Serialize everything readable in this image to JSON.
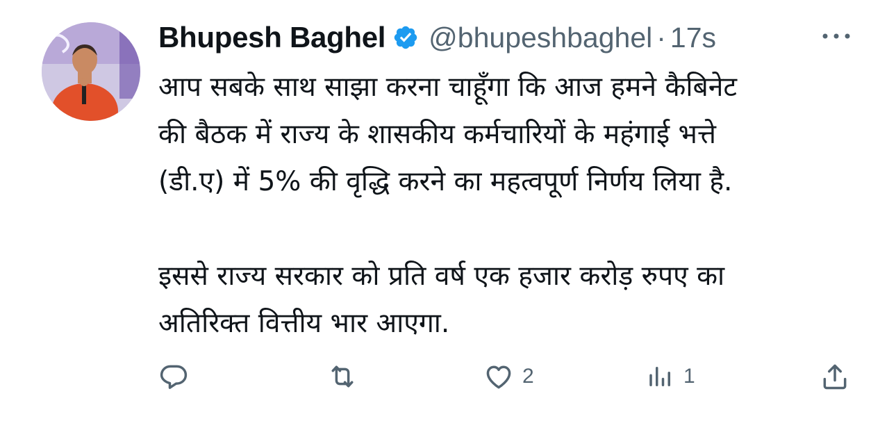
{
  "author": {
    "display_name": "Bhupesh Baghel",
    "handle": "@bhupeshbaghel",
    "separator": "·",
    "time": "17s",
    "verified": true,
    "verified_color": "#1d9bf0"
  },
  "tweet": {
    "paragraphs": [
      [
        "आप सबके साथ साझा करना चाहूँगा कि आज हमने कैबिनेट",
        "की बैठक में राज्य के शासकीय कर्मचारियों के महंगाई भत्ते",
        "(डी.ए) में 5% की वृद्धि करने का महत्वपूर्ण निर्णय लिया है."
      ],
      [
        "इससे राज्य सरकार को प्रति वर्ष एक हजार करोड़ रुपए का",
        "अतिरिक्त वित्तीय भार आएगा."
      ]
    ]
  },
  "actions": {
    "reply": {
      "icon": "reply-icon",
      "count": ""
    },
    "retweet": {
      "icon": "retweet-icon",
      "count": ""
    },
    "like": {
      "icon": "heart-icon",
      "count": "2"
    },
    "views": {
      "icon": "views-icon",
      "count": "1"
    },
    "share": {
      "icon": "share-icon",
      "count": ""
    }
  },
  "colors": {
    "text": "#0f1419",
    "secondary": "#536471",
    "accent": "#1d9bf0"
  }
}
